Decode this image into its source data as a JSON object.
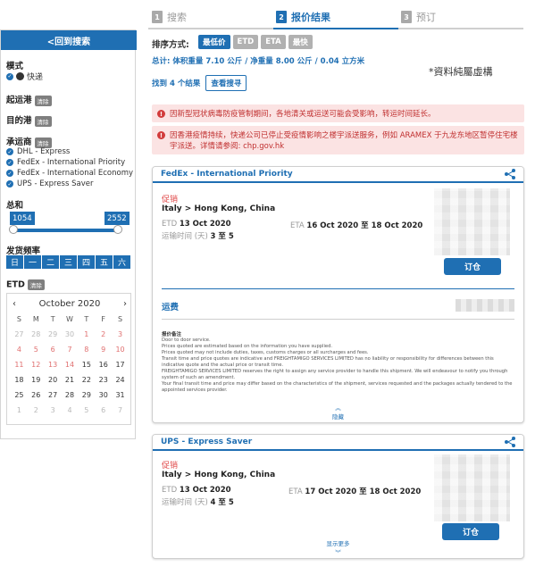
{
  "steps": [
    {
      "num": "1",
      "label": "搜索"
    },
    {
      "num": "2",
      "label": "报价结果"
    },
    {
      "num": "3",
      "label": "预订"
    }
  ],
  "sidebar": {
    "back_label": "<回到搜索",
    "mode_title": "模式",
    "mode_value": "快递",
    "origin_title": "起运港",
    "dest_title": "目的港",
    "clear_tag": "清除",
    "carrier_title": "承运商",
    "carriers": [
      "DHL - Express",
      "FedEx - International Priority",
      "FedEx - International Economy",
      "UPS - Express Saver"
    ],
    "total_title": "总和",
    "range_min": "1054",
    "range_max": "2552",
    "freq_title": "发货频率",
    "weekdays": [
      "日",
      "一",
      "二",
      "三",
      "四",
      "五",
      "六"
    ],
    "etd_title": "ETD",
    "calendar": {
      "month_label": "October 2020",
      "dow": [
        "S",
        "M",
        "T",
        "W",
        "T",
        "F",
        "S"
      ],
      "weeks": [
        [
          "27",
          "28",
          "29",
          "30",
          "1",
          "2",
          "3"
        ],
        [
          "4",
          "5",
          "6",
          "7",
          "8",
          "9",
          "10"
        ],
        [
          "11",
          "12",
          "13",
          "14",
          "15",
          "16",
          "17"
        ],
        [
          "18",
          "19",
          "20",
          "21",
          "22",
          "23",
          "24"
        ],
        [
          "25",
          "26",
          "27",
          "28",
          "29",
          "30",
          "31"
        ],
        [
          "1",
          "2",
          "3",
          "4",
          "5",
          "6",
          "7"
        ]
      ]
    }
  },
  "sort": {
    "label": "排序方式:",
    "options": [
      "最低价",
      "ETD",
      "ETA",
      "最快"
    ]
  },
  "totals_text": "总计: 体积重量 7.10 公斤 / 净重量 8.00 公斤 / 0.04 立方米",
  "disclaimer": "*資料純屬虛構",
  "found_text": "找到 4 个结果",
  "view_search_label": "查看搜寻",
  "notices": [
    "因新型冠状病毒防疫管制期间，各地清关或运送可能会受影响，转运时间延长。",
    "因香港疫情持续，快递公司已停止受疫情影响之楼宇派送服务，例如 ARAMEX 于九龙东地区暂停住宅楼宇派送。详情请参阅: chp.gov.hk"
  ],
  "cards": [
    {
      "title": "FedEx - International Priority",
      "promo": "促销",
      "route": "Italy > Hong Kong, China",
      "etd_label": "ETD",
      "etd_value": "13 Oct 2020",
      "eta_label": "ETA",
      "eta_value": "16 Oct 2020 至 18 Oct 2020",
      "transit_label": "运输时间 (天)",
      "transit_value": "3 至 5",
      "order_label": "订仓",
      "fee_label": "运费",
      "fine_title": "报价备注",
      "fine_lines": [
        "Door to door service.",
        "Prices quoted are estimated based on the information you have supplied.",
        "Prices quoted may not include duties, taxes, customs charges or all surcharges and fees.",
        "Transit time and price quotes are indicative and FREIGHTAMIGO SERVICES LIMITED has no liability or responsibility for differences between this indicative quote and the actual price or transit time.",
        "FREIGHTAMIGO SERVICES LIMITED reserves the right to assign any service provider to handle this shipment. We will endeavour to notify you through system of such an amendment.",
        "Your final transit time and price may differ based on the characteristics of the shipment, services requested and the packages actually tendered to the appointed services provider."
      ],
      "collapse_label": "隐藏"
    },
    {
      "title": "UPS - Express Saver",
      "promo": "促销",
      "route": "Italy > Hong Kong, China",
      "etd_label": "ETD",
      "etd_value": "13 Oct 2020",
      "eta_label": "ETA",
      "eta_value": "17 Oct 2020 至 18 Oct 2020",
      "transit_label": "运输时间 (天)",
      "transit_value": "4 至 5",
      "order_label": "订仓",
      "more_label": "显示更多"
    }
  ],
  "colors": {
    "accent": "#1f6fb3",
    "promo": "#e04848",
    "notice_bg": "#fbe3e3",
    "notice_text": "#c03030"
  }
}
